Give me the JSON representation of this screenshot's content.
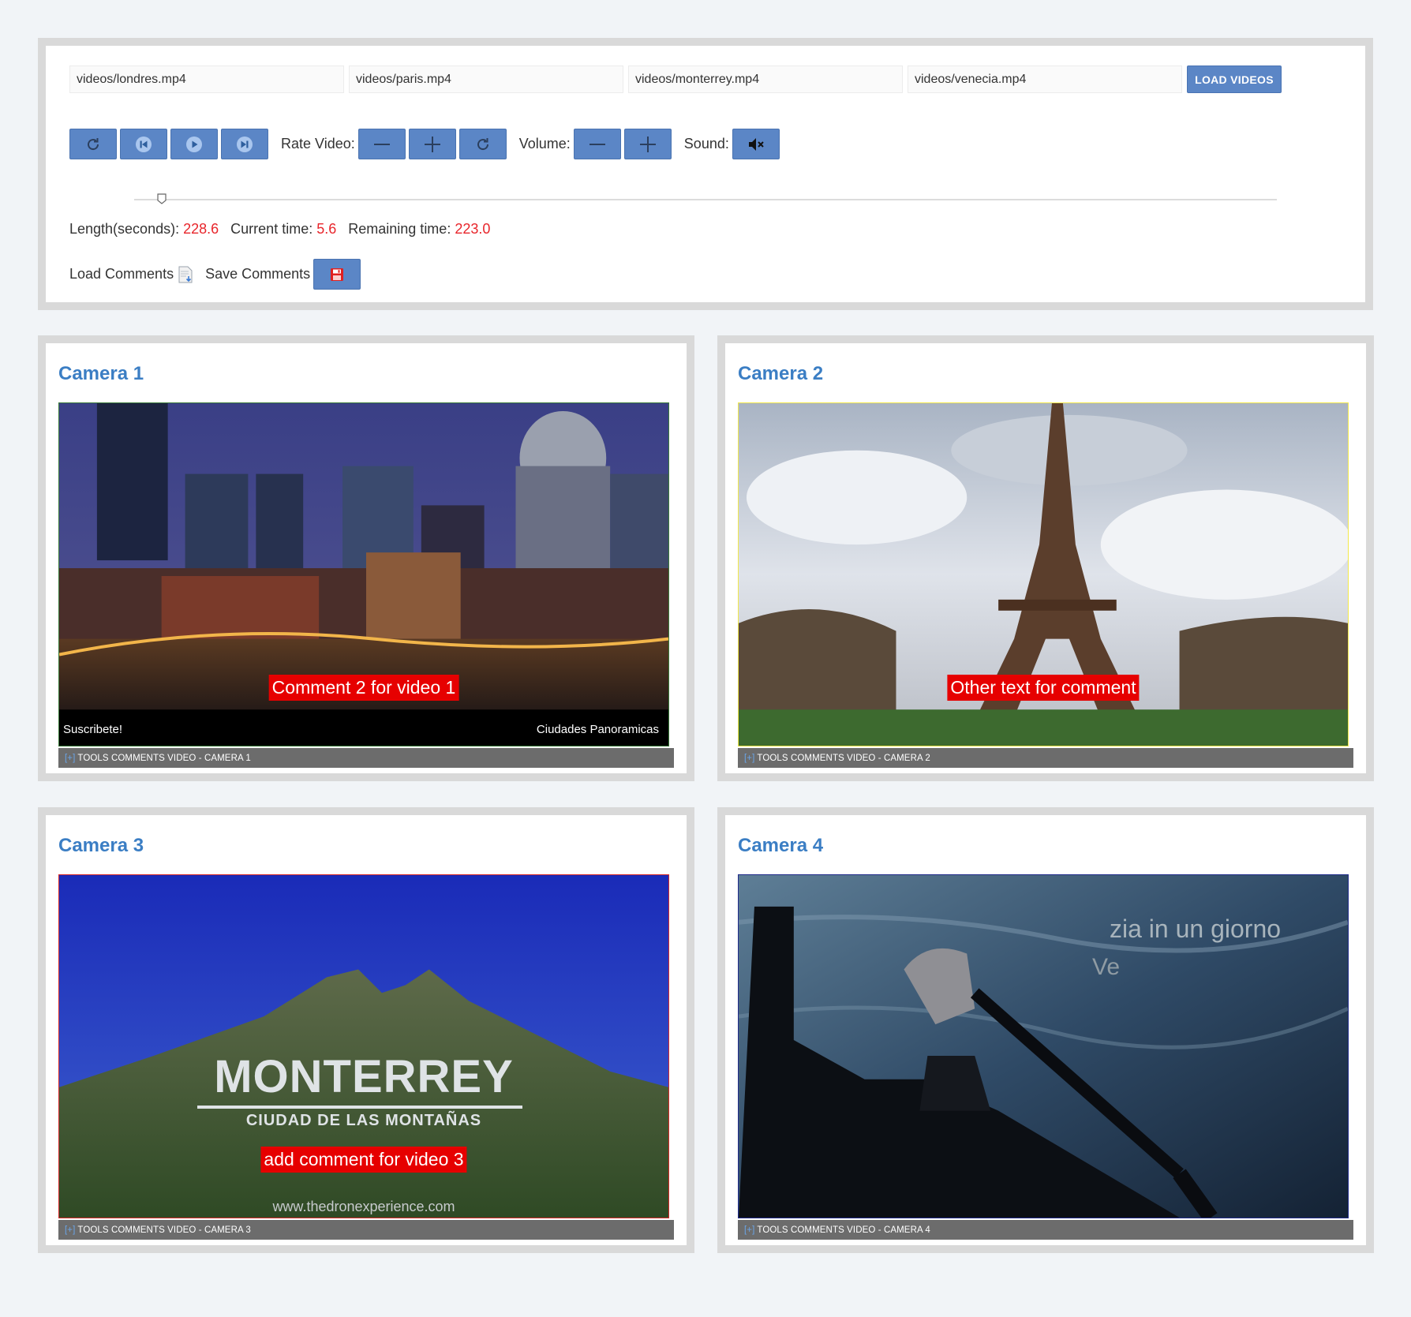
{
  "files": {
    "inputs": [
      "videos/londres.mp4",
      "videos/paris.mp4",
      "videos/monterrey.mp4",
      "videos/venecia.mp4"
    ],
    "load_label": "LOAD VIDEOS"
  },
  "controls": {
    "rate_label": "Rate Video:",
    "volume_label": "Volume:",
    "sound_label": "Sound:",
    "icons": [
      "reload-icon",
      "previous-icon",
      "play-icon",
      "next-icon",
      "minus-icon",
      "plus-icon",
      "reset-icon",
      "minus-icon",
      "plus-icon",
      "mute-icon"
    ]
  },
  "progress": {
    "current": 5.6,
    "length": 228.6
  },
  "times": {
    "length_label": "Length(seconds):",
    "length_value": "228.6",
    "current_label": "Current time:",
    "current_value": "5.6",
    "remaining_label": "Remaining time:",
    "remaining_value": "223.0"
  },
  "comments": {
    "load_label": "Load Comments",
    "save_label": "Save Comments"
  },
  "cameras": [
    {
      "title": "Camera 1",
      "comment": "Comment 2 for video 1",
      "toolbar_expand": "[+]",
      "toolbar_label": "TOOLS COMMENTS VIDEO - CAMERA 1",
      "caption_left": "Suscribete!",
      "caption_right": "Ciudades Panoramicas"
    },
    {
      "title": "Camera 2",
      "comment": "Other text for comment",
      "toolbar_expand": "[+]",
      "toolbar_label": "TOOLS COMMENTS VIDEO - CAMERA 2"
    },
    {
      "title": "Camera 3",
      "comment": "add comment for video 3",
      "toolbar_expand": "[+]",
      "toolbar_label": "TOOLS COMMENTS VIDEO - CAMERA 3",
      "video_title": "MONTERREY",
      "video_subtitle": "CIUDAD DE LAS MONTAÑAS",
      "video_url": "www.thedronexperience.com"
    },
    {
      "title": "Camera 4",
      "comment": "",
      "toolbar_expand": "[+]",
      "toolbar_label": "TOOLS COMMENTS VIDEO - CAMERA 4",
      "video_text_1": "zia in un giorno",
      "video_text_2": "Ve"
    }
  ],
  "colors": {
    "accent": "#5b86c6",
    "title": "#3b7ec4",
    "value_red": "#e8252b",
    "comment_bg": "#e60000"
  }
}
